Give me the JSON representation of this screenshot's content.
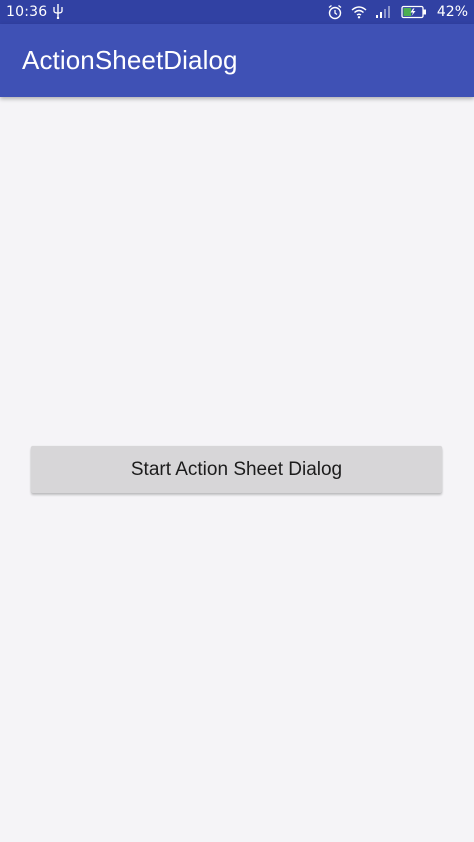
{
  "status_bar": {
    "time": "10:36",
    "battery_percent": "42%",
    "icons": [
      "usb-icon",
      "alarm-icon",
      "wifi-icon",
      "signal-icon",
      "battery-icon"
    ],
    "battery_level": 0.42
  },
  "app_bar": {
    "title": "ActionSheetDialog"
  },
  "main": {
    "start_button_label": "Start Action Sheet Dialog"
  },
  "colors": {
    "status_bar": "#3141a3",
    "app_bar": "#3f51b5",
    "background": "#f5f4f7",
    "button": "#d7d6d8",
    "battery_charge": "#4caf50"
  }
}
